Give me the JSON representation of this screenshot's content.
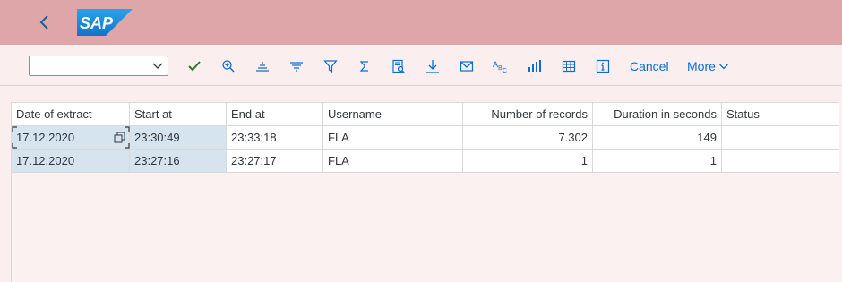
{
  "header": {
    "back_icon": "chevron-left-icon",
    "logo_text": "SAP",
    "brand_color": "#1d8ad6",
    "bg_color": "#dea6a8"
  },
  "toolbar": {
    "variant_value": "",
    "icons": [
      "check-icon",
      "search-zoom-icon",
      "sort-ascending-icon",
      "sort-descending-icon",
      "filter-icon",
      "sum-icon",
      "preview-document-icon",
      "download-icon",
      "email-icon",
      "spell-check-icon",
      "bar-chart-icon",
      "grid-layout-icon",
      "information-icon"
    ],
    "cancel_label": "Cancel",
    "more_label": "More",
    "accent": "#0a6ed1"
  },
  "table": {
    "columns": [
      "Date of extract",
      "Start at",
      "End at",
      "Username",
      "Number of records",
      "Duration in seconds",
      "Status"
    ],
    "rows": [
      [
        "17.12.2020",
        "23:30:49",
        "23:33:18",
        "FLA",
        "7.302",
        "149",
        ""
      ],
      [
        "17.12.2020",
        "23:27:16",
        "23:27:17",
        "FLA",
        "1",
        "1",
        ""
      ]
    ]
  }
}
